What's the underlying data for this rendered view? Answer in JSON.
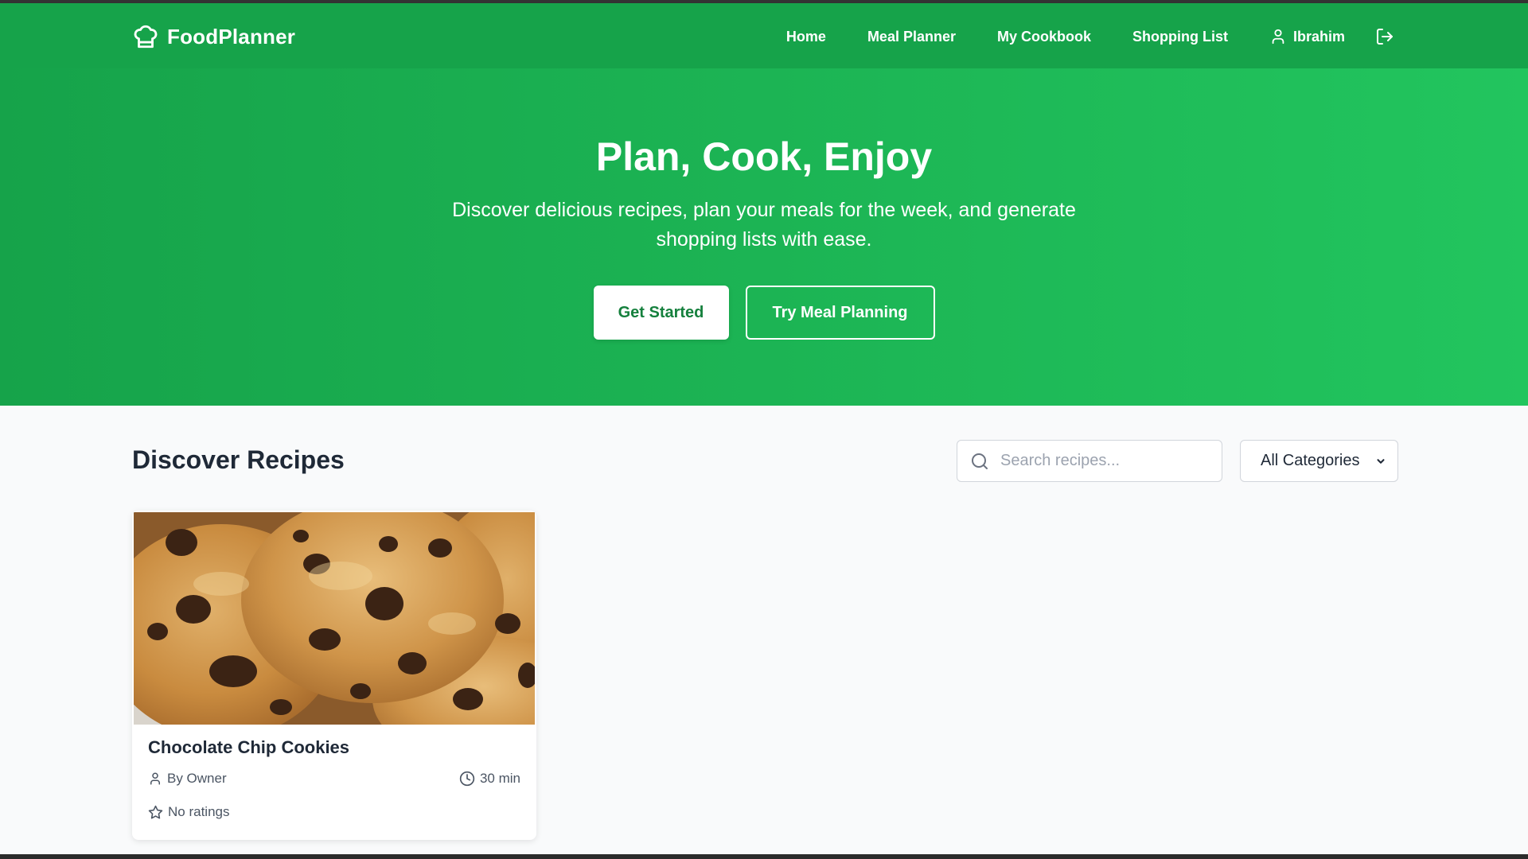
{
  "brand": {
    "name": "FoodPlanner",
    "icon": "chef-hat-icon"
  },
  "nav": {
    "links": [
      "Home",
      "Meal Planner",
      "My Cookbook",
      "Shopping List"
    ],
    "user_name": "Ibrahim",
    "user_icon": "user-icon",
    "logout_icon": "logout-icon"
  },
  "hero": {
    "title": "Plan, Cook, Enjoy",
    "subtitle": "Discover delicious recipes, plan your meals for the week, and generate shopping lists with ease.",
    "primary_button": "Get Started",
    "secondary_button": "Try Meal Planning"
  },
  "recipes": {
    "section_title": "Discover Recipes",
    "search_placeholder": "Search recipes...",
    "category_selected": "All Categories",
    "cards": [
      {
        "title": "Chocolate Chip Cookies",
        "author": "By Owner",
        "time": "30 min",
        "rating": "No ratings"
      }
    ]
  },
  "colors": {
    "primary": "#16a34a",
    "primary_light": "#22c55e",
    "primary_dark_text": "#15803d",
    "heading": "#1f2937",
    "muted": "#4b5563",
    "background": "#f9fafb"
  }
}
